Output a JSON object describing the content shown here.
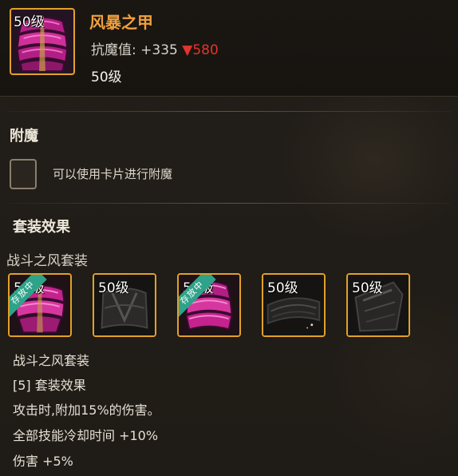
{
  "item": {
    "level_badge": "50级",
    "name": "风暴之甲",
    "stat_label": "抗魔值:",
    "stat_value": "+335",
    "stat_delta": "▼580",
    "level": "50级"
  },
  "enchant": {
    "title": "附魔",
    "hint": "可以使用卡片进行附魔"
  },
  "set_effect": {
    "title": "套装效果",
    "set_name": "战斗之风套装",
    "pieces": [
      {
        "level": "50级",
        "ribbon": "存放中",
        "style": "pink"
      },
      {
        "level": "50级",
        "ribbon": "",
        "style": "dark"
      },
      {
        "level": "50级",
        "ribbon": "存放中",
        "style": "pink"
      },
      {
        "level": "50级",
        "ribbon": "",
        "style": "dark"
      },
      {
        "level": "50级",
        "ribbon": "",
        "style": "dark"
      }
    ],
    "desc_lines": [
      "战斗之风套装",
      "[5] 套装效果",
      "攻击时,附加15%的伤害。",
      "全部技能冷却时间 +10%",
      "伤害 +5%"
    ]
  },
  "colors": {
    "accent_gold": "#e2a128",
    "name_orange": "#f2a03c",
    "down_red": "#e3342c",
    "ribbon_teal": "#2fa38a",
    "armor_pink": "#c4238e"
  },
  "icons": {
    "item": "storm-armor-icon",
    "pink_piece": "pink-armor-piece-icon",
    "dark_piece": "dark-armor-piece-icon"
  }
}
